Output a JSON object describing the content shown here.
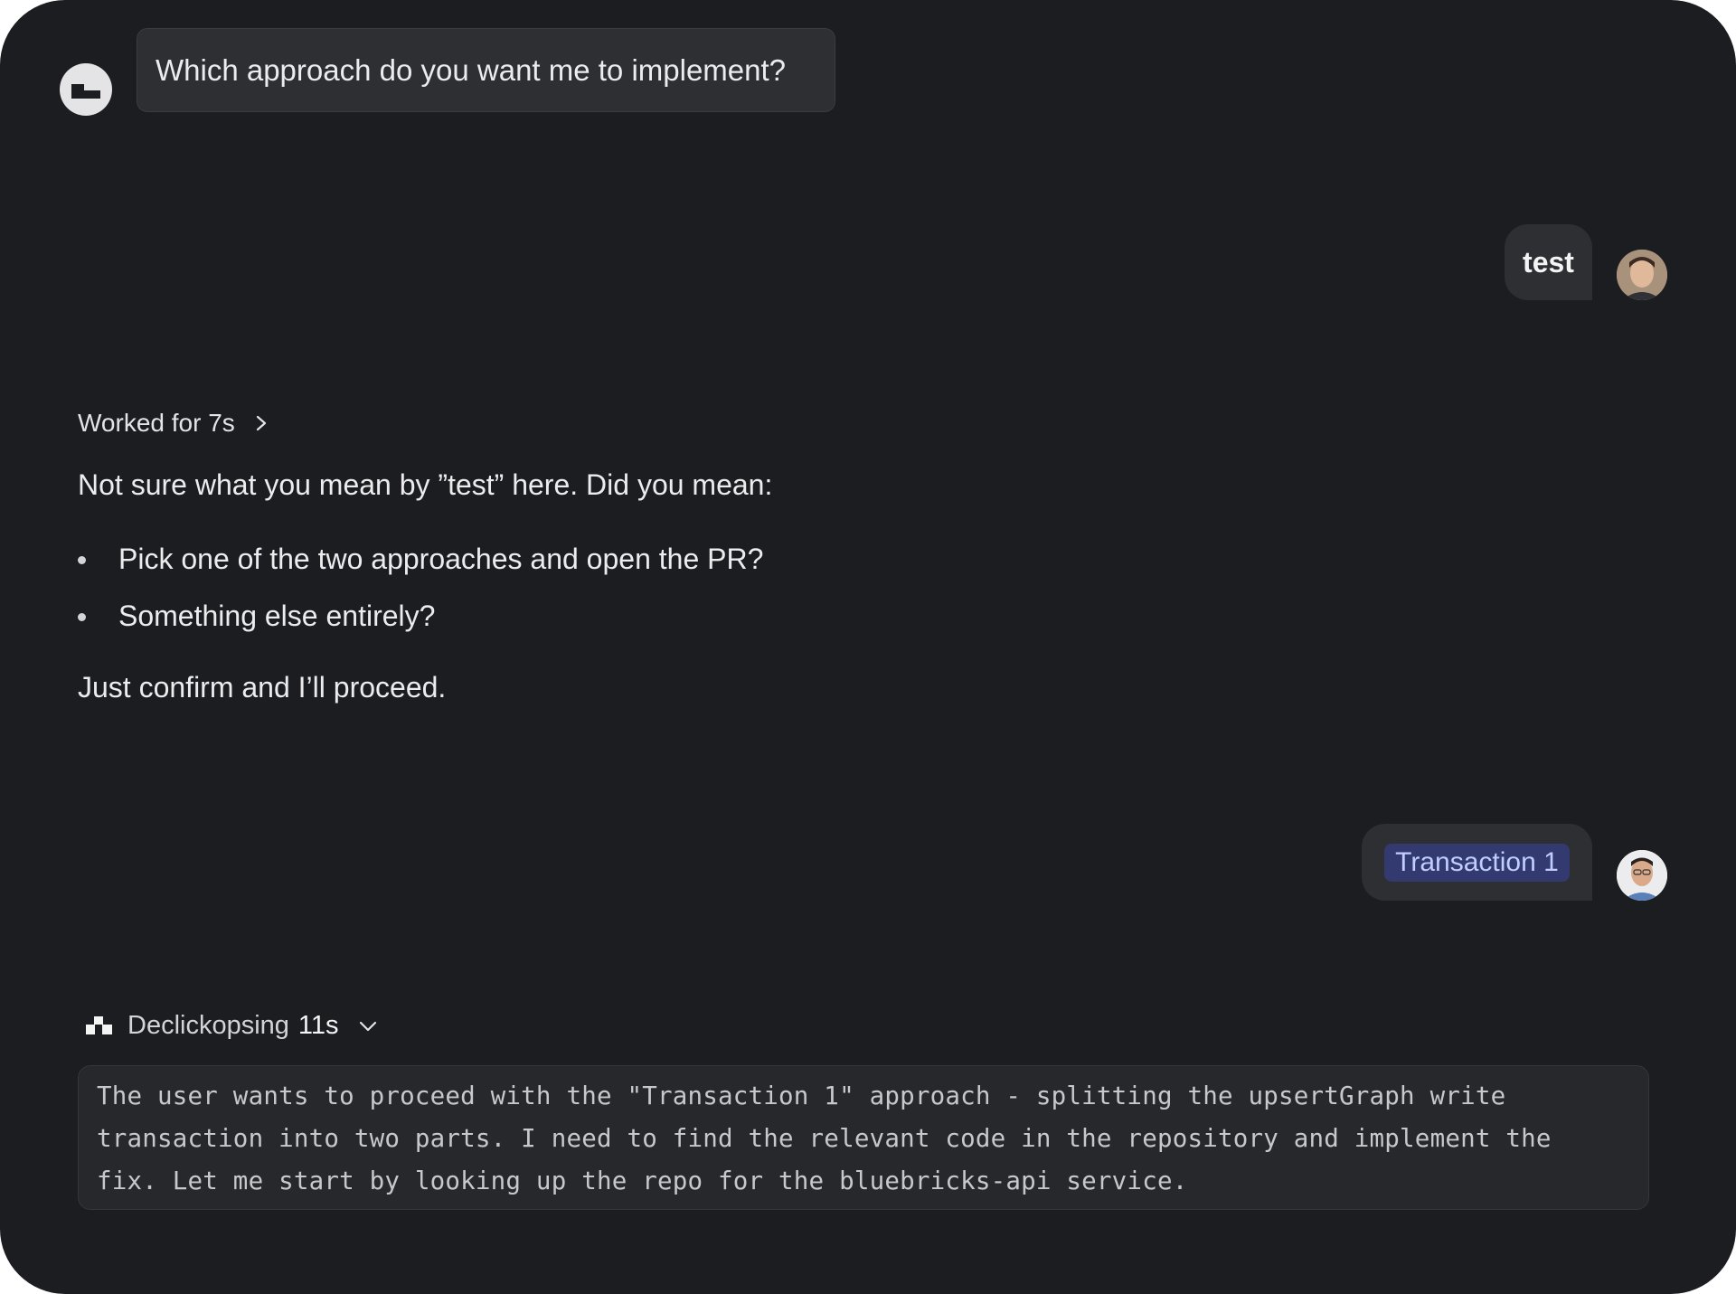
{
  "messages": {
    "assistant_question": "Which approach do you want me to implement?",
    "user_reply_1": "test",
    "worked_label": "Worked for 7s",
    "response_intro": "Not sure what you mean by ”test” here. Did you mean:",
    "response_options": [
      "Pick one of the two approaches and open the PR?",
      "Something else entirely?"
    ],
    "response_outro": "Just confirm and I’ll proceed.",
    "user_reply_2_chip": "Transaction 1"
  },
  "thinking": {
    "label": "Declickopsing",
    "duration": "11s",
    "lines": [
      "The user wants to proceed with the \"Transaction 1\" approach - splitting the upsertGraph write",
      "transaction into two parts. I need to find the relevant code in the repository and implement the",
      "fix. Let me start by looking up the repo for the bluebricks-api service."
    ]
  },
  "icons": {
    "assistant_avatar": "assistant-logo-icon",
    "worked_toggle": "chevron-right-icon",
    "thinking_toggle": "chevron-down-icon",
    "thinking_icon": "thinking-blocks-icon"
  },
  "colors": {
    "background": "#1c1d20",
    "bubble": "#2e2f33",
    "chip_bg": "#323a70",
    "chip_text": "#c2cdff"
  }
}
